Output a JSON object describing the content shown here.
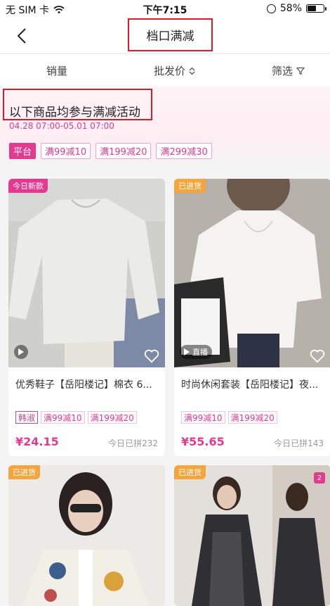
{
  "status_bar": {
    "carrier": "无 SIM 卡",
    "time": "下午7:15",
    "battery": "58%",
    "battery_level": 0.58
  },
  "nav": {
    "title": "档口满减"
  },
  "filters": {
    "sales": "销量",
    "price": "批发价",
    "filter": "筛选"
  },
  "promo": {
    "title": "以下商品均参与满减活动",
    "time": "04.28 07:00-05.01 07:00",
    "platform_tag": "平台",
    "discounts": [
      "满99减10",
      "满199减20",
      "满299减30"
    ]
  },
  "products": [
    {
      "badge": "今日新款",
      "name": "优秀鞋子【岳阳楼记】棉衣 6...",
      "shop_tag": "韩淑",
      "tags": [
        "满99减10",
        "满199减20"
      ],
      "price": "¥24.15",
      "sold": "今日已拼232",
      "media": ""
    },
    {
      "badge": "已进货",
      "name": "时尚休闲套装【岳阳楼记】夜...",
      "shop_tag": "",
      "tags": [
        "满99减10",
        "满199减20"
      ],
      "price": "¥55.65",
      "sold": "今日已拼143",
      "media": "直播"
    },
    {
      "badge": "已进货"
    },
    {
      "badge": "已进货",
      "count": "2"
    }
  ]
}
